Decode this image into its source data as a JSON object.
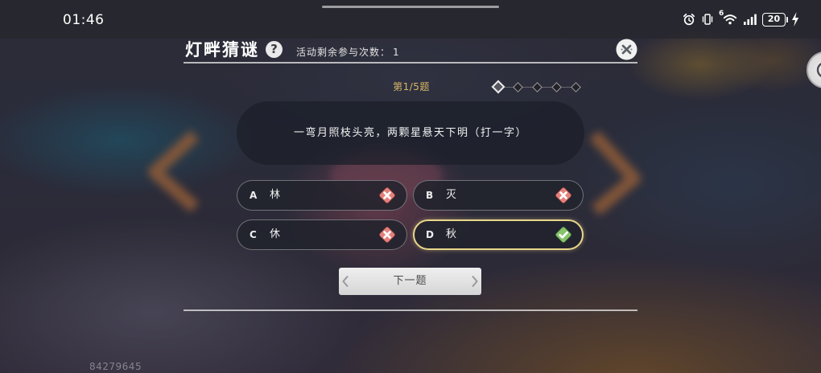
{
  "status_bar": {
    "time": "01:46",
    "wifi_badge": "6",
    "battery_percent": "20"
  },
  "header": {
    "title": "灯畔猜谜",
    "remaining_label": "活动剩余参与次数：",
    "remaining_count": "1"
  },
  "progress": {
    "label": "第1/5题",
    "current": 1,
    "total": 5
  },
  "question": {
    "text": "一弯月照枝头亮，两颗星悬天下明（打一字）"
  },
  "options": [
    {
      "letter": "A",
      "text": "林",
      "icon": "cross-icon",
      "selected": false
    },
    {
      "letter": "B",
      "text": "灭",
      "icon": "cross-icon",
      "selected": false
    },
    {
      "letter": "C",
      "text": "休",
      "icon": "cross-icon",
      "selected": false
    },
    {
      "letter": "D",
      "text": "秋",
      "icon": "check-icon",
      "selected": true
    }
  ],
  "next_button": {
    "label": "下一题"
  },
  "footer": {
    "uid": "84279645"
  },
  "icons": {
    "help": "question-icon",
    "close": "close-icon",
    "status": [
      "alarm-icon",
      "vibrate-icon",
      "wifi-icon",
      "signal-icon",
      "battery-icon",
      "charging-icon"
    ]
  },
  "colors": {
    "progress_gold": "#d9b766",
    "selected_border": "#e9d68a",
    "wrong_icon": "#e4817c",
    "correct_icon": "#86c36b"
  }
}
